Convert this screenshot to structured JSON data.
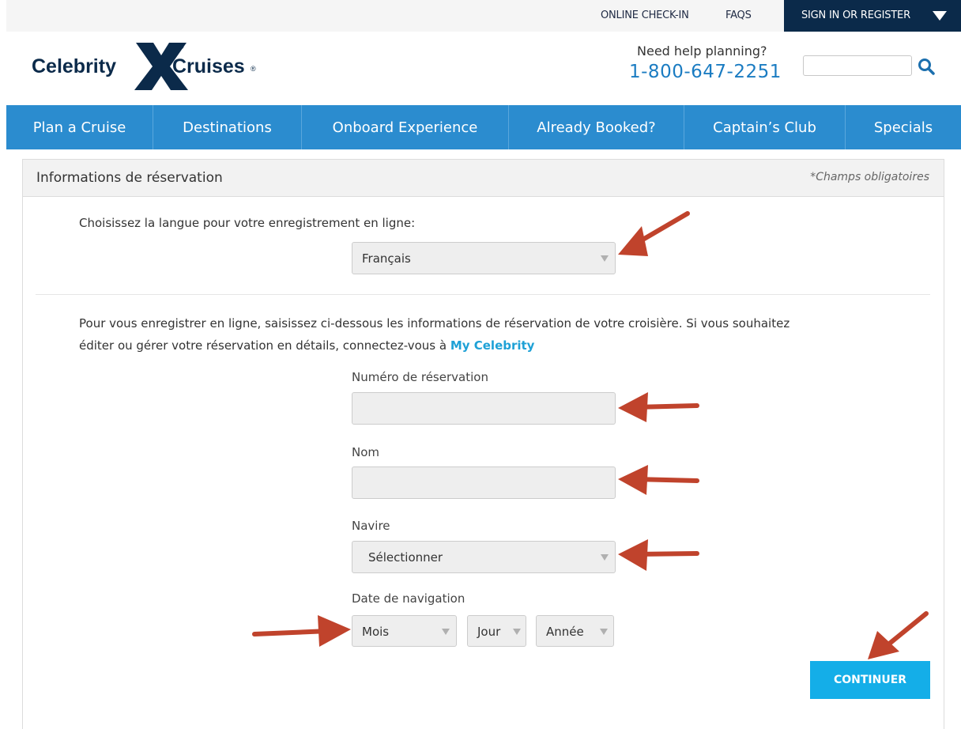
{
  "topbar": {
    "online_checkin": "ONLINE CHECK-IN",
    "faqs": "FAQS",
    "signin": "SIGN IN OR REGISTER"
  },
  "header": {
    "logo_left": "Celebrity",
    "logo_right": "Cruises",
    "help_text": "Need help planning?",
    "phone": "1-800-647-2251",
    "search_placeholder": ""
  },
  "nav": {
    "items": [
      {
        "label": "Plan a Cruise"
      },
      {
        "label": "Destinations"
      },
      {
        "label": "Onboard Experience"
      },
      {
        "label": "Already Booked?"
      },
      {
        "label": "Captain’s Club"
      },
      {
        "label": "Specials"
      }
    ]
  },
  "panel": {
    "title": "Informations de réservation",
    "required_note": "*Champs obligatoires",
    "language_prompt": "Choisissez la langue pour votre enregistrement en ligne:",
    "language_value": "Français",
    "intro_line1": "Pour vous enregistrer en ligne, saisissez ci-dessous les informations de réservation de votre croisière. Si vous souhaitez",
    "intro_line2": "éditer ou gérer votre réservation en détails, connectez-vous à ",
    "intro_link": "My Celebrity",
    "reservation_label": "Numéro de réservation",
    "reservation_value": "",
    "name_label": "Nom",
    "name_value": "",
    "ship_label": "Navire",
    "ship_value": "Sélectionner",
    "date_label": "Date de navigation",
    "month_value": "Mois",
    "day_value": "Jour",
    "year_value": "Année",
    "continue_label": "CONTINUER"
  },
  "colors": {
    "nav_blue": "#2b8ccf",
    "brand_navy": "#0b2a4a",
    "button_cyan": "#14aee8",
    "arrow_red": "#c0432c"
  }
}
